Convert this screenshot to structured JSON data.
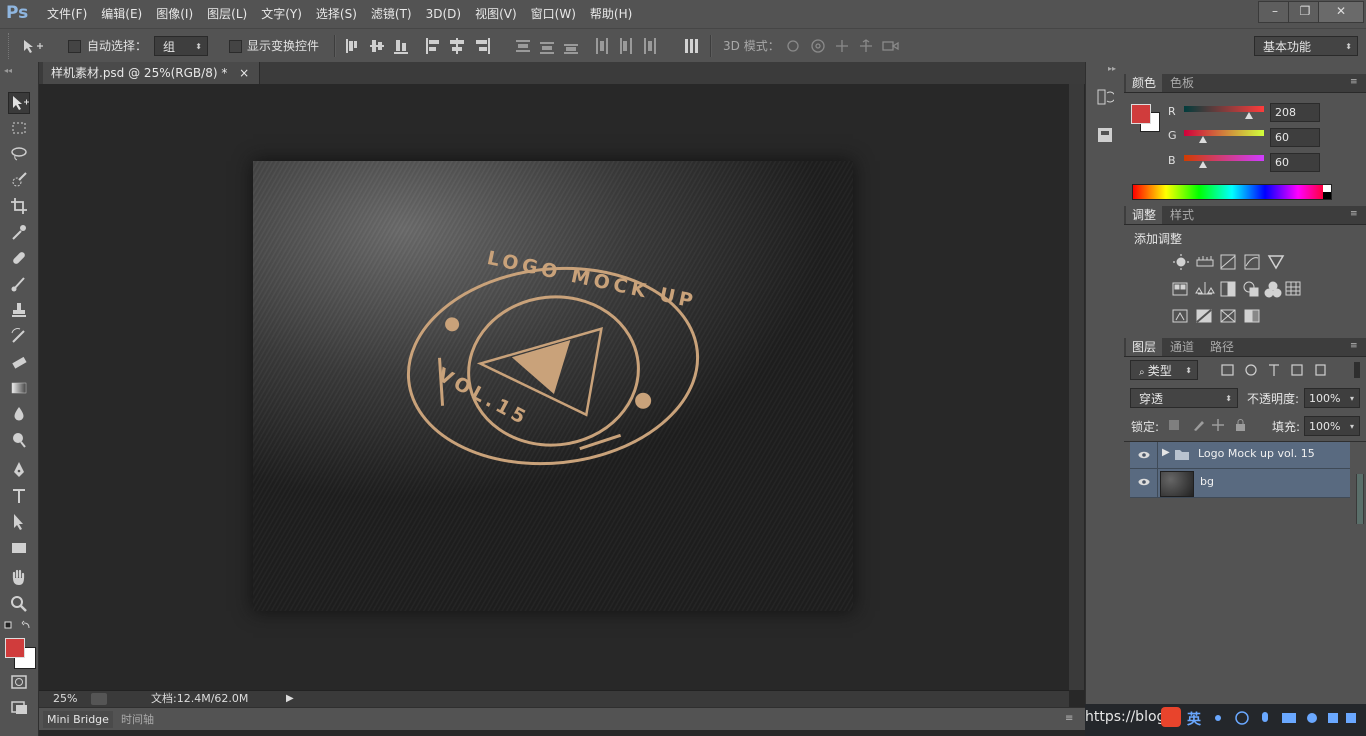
{
  "app": {
    "logo": "Ps",
    "menus": [
      "文件(F)",
      "编辑(E)",
      "图像(I)",
      "图层(L)",
      "文字(Y)",
      "选择(S)",
      "滤镜(T)",
      "3D(D)",
      "视图(V)",
      "窗口(W)",
      "帮助(H)"
    ],
    "window_controls": {
      "minimize": "–",
      "restore": "❐",
      "close": "✕"
    }
  },
  "options": {
    "auto_select_label": "自动选择：",
    "auto_select_value": "组",
    "show_transform_label": "显示变换控件",
    "mode_3d_label": "3D 模式：",
    "workspace": "基本功能"
  },
  "document": {
    "tab_title": "样机素材.psd @ 25%(RGB/8) *",
    "tab_close": "×",
    "zoom": "25%",
    "doc_info": "文档:12.4M/62.0M",
    "bottom_tabs": [
      "Mini Bridge",
      "时间轴"
    ]
  },
  "color_panel": {
    "tabs": [
      "颜色",
      "色板"
    ],
    "fg_color": "#d03c3c",
    "bg_color": "#ffffff",
    "channels": [
      {
        "label": "R",
        "value": "208",
        "level": 0.815
      },
      {
        "label": "G",
        "value": "60",
        "level": 0.235
      },
      {
        "label": "B",
        "value": "60",
        "level": 0.235
      }
    ]
  },
  "adjust_panel": {
    "tabs": [
      "调整",
      "样式"
    ],
    "title": "添加调整"
  },
  "layers_panel": {
    "tabs": [
      "图层",
      "通道",
      "路径"
    ],
    "filter_kind": "类型",
    "blend_mode": "穿透",
    "opacity_label": "不透明度:",
    "opacity": "100%",
    "lock_label": "锁定:",
    "fill_label": "填充:",
    "fill": "100%",
    "layers": [
      {
        "name": "Logo Mock up vol. 15",
        "type": "group"
      },
      {
        "name": "bg",
        "type": "pixel"
      }
    ]
  },
  "artwork": {
    "logo_top_text": "LOGO MOCK UP",
    "logo_bottom_text": "VOL.15",
    "gold": "#c9a27a"
  },
  "taskbar": {
    "url_text": "https://blog",
    "ime_label": "英"
  }
}
